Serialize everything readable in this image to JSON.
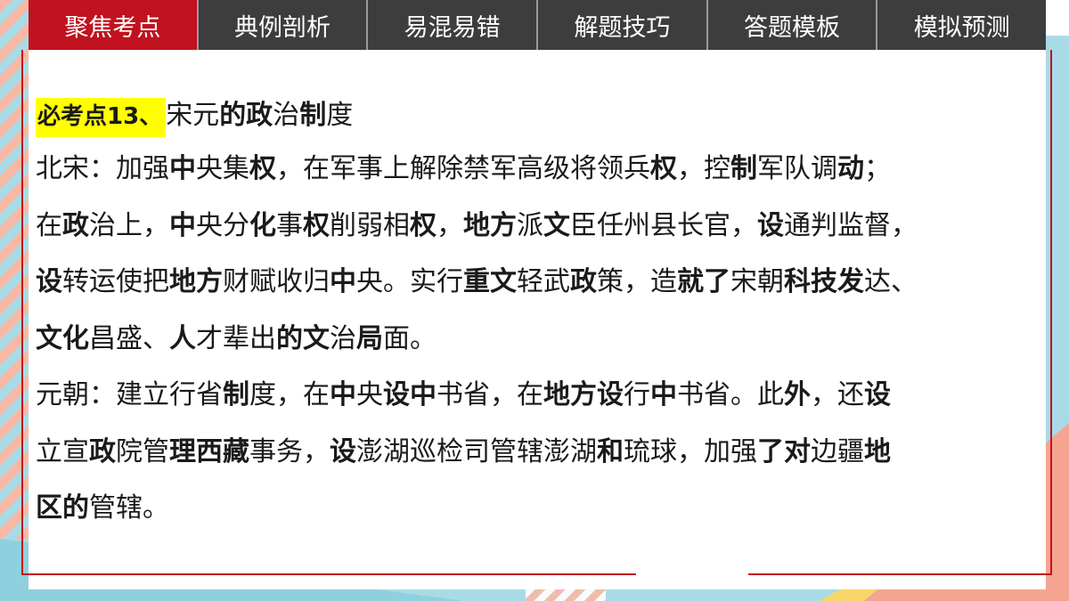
{
  "tabs": [
    {
      "label": "聚焦考点",
      "active": true
    },
    {
      "label": "典例剖析",
      "active": false
    },
    {
      "label": "易混易错",
      "active": false
    },
    {
      "label": "解题技巧",
      "active": false
    },
    {
      "label": "答题模板",
      "active": false
    },
    {
      "label": "模拟预测",
      "active": false
    }
  ],
  "colors": {
    "active_tab": "#c1121f",
    "tab_bar": "#3d3d3d",
    "highlight": "#ffff00"
  },
  "heading": {
    "tag": "必考点13、",
    "runs": [
      "宋元",
      "的政",
      "治",
      "制",
      "度"
    ]
  },
  "lines": [
    [
      "北宋：加强",
      "中",
      "央集",
      "权",
      "，在军事上解除禁军高级将领兵",
      "权",
      "，控",
      "制",
      "军队调",
      "动",
      "；"
    ],
    [
      "在",
      "政",
      "治上，",
      "中",
      "央分",
      "化",
      "事",
      "权",
      "削弱相",
      "权",
      "，",
      "地方",
      "派",
      "文",
      "臣任州县长官，",
      "设",
      "通判监督，"
    ],
    [
      "设",
      "转运使把",
      "地方",
      "财赋收归",
      "中",
      "央。实行",
      "重文",
      "轻武",
      "政",
      "策，造",
      "就了",
      "宋朝",
      "科技发",
      "达、"
    ],
    [
      "文化",
      "昌盛、",
      "人",
      "才辈出",
      "的文",
      "治",
      "局",
      "面。"
    ],
    [
      "元朝：建立行省",
      "制",
      "度，在",
      "中",
      "央",
      "设中",
      "书省，在",
      "地方设",
      "行",
      "中",
      "书省。此",
      "外",
      "，还",
      "设"
    ],
    [
      "立宣",
      "政",
      "院管",
      "理西藏",
      "事务，",
      "设",
      "澎湖巡检司管辖澎湖",
      "和",
      "琉球，加强",
      "了对",
      "边疆",
      "地"
    ],
    [
      "区的",
      "管辖。"
    ]
  ]
}
